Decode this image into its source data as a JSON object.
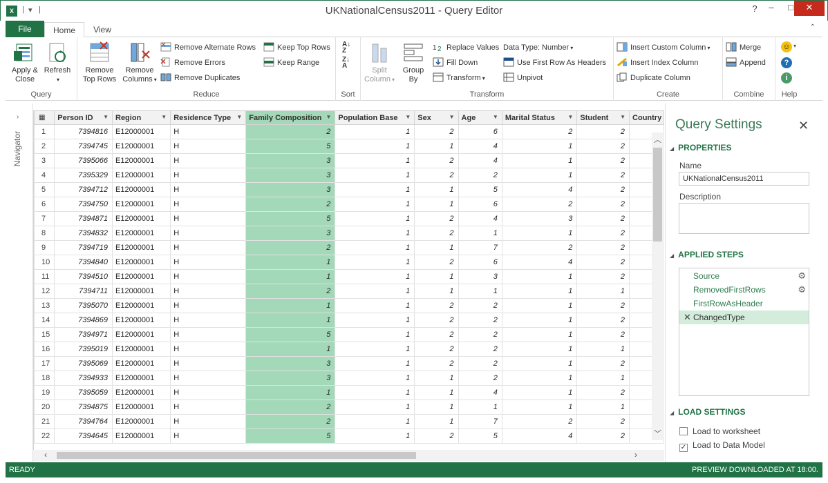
{
  "window": {
    "title": "UKNationalCensus2011 - Query Editor",
    "app_icon": "X"
  },
  "tabs": [
    {
      "label": "File"
    },
    {
      "label": "Home"
    },
    {
      "label": "View"
    }
  ],
  "ribbon": {
    "query": {
      "label": "Query",
      "apply_close": [
        "Apply &",
        "Close"
      ],
      "refresh": "Refresh"
    },
    "reduce": {
      "label": "Reduce",
      "remove_top_rows": [
        "Remove",
        "Top Rows"
      ],
      "remove_columns": [
        "Remove",
        "Columns"
      ],
      "remove_alternate_rows": "Remove Alternate Rows",
      "remove_errors": "Remove Errors",
      "remove_duplicates": "Remove Duplicates",
      "keep_top_rows": "Keep Top Rows",
      "keep_range": "Keep Range"
    },
    "sort": {
      "label": "Sort"
    },
    "transform": {
      "label": "Transform",
      "split_column": [
        "Split",
        "Column"
      ],
      "group_by": [
        "Group",
        "By"
      ],
      "replace_values": "Replace Values",
      "fill_down": "Fill Down",
      "transform": "Transform",
      "data_type": "Data Type: Number",
      "use_first_row": "Use First Row As Headers",
      "unpivot": "Unpivot"
    },
    "create": {
      "label": "Create",
      "insert_custom_column": "Insert Custom Column",
      "insert_index_column": "Insert Index Column",
      "duplicate_column": "Duplicate Column"
    },
    "combine": {
      "label": "Combine",
      "merge": "Merge",
      "append": "Append"
    },
    "help": {
      "label": "Help"
    }
  },
  "navigator": {
    "label": "Navigator"
  },
  "grid": {
    "columns": [
      "Person ID",
      "Region",
      "Residence Type",
      "Family Composition",
      "Population Base",
      "Sex",
      "Age",
      "Marital Status",
      "Student",
      "Country"
    ],
    "rows": [
      [
        "1",
        "7394816",
        "E12000001",
        "H",
        "2",
        "1",
        "2",
        "6",
        "2",
        "2"
      ],
      [
        "2",
        "7394745",
        "E12000001",
        "H",
        "5",
        "1",
        "1",
        "4",
        "1",
        "2"
      ],
      [
        "3",
        "7395066",
        "E12000001",
        "H",
        "3",
        "1",
        "2",
        "4",
        "1",
        "2"
      ],
      [
        "4",
        "7395329",
        "E12000001",
        "H",
        "3",
        "1",
        "2",
        "2",
        "1",
        "2"
      ],
      [
        "5",
        "7394712",
        "E12000001",
        "H",
        "3",
        "1",
        "1",
        "5",
        "4",
        "2"
      ],
      [
        "6",
        "7394750",
        "E12000001",
        "H",
        "2",
        "1",
        "1",
        "6",
        "2",
        "2"
      ],
      [
        "7",
        "7394871",
        "E12000001",
        "H",
        "5",
        "1",
        "2",
        "4",
        "3",
        "2"
      ],
      [
        "8",
        "7394832",
        "E12000001",
        "H",
        "3",
        "1",
        "2",
        "1",
        "1",
        "2"
      ],
      [
        "9",
        "7394719",
        "E12000001",
        "H",
        "2",
        "1",
        "1",
        "7",
        "2",
        "2"
      ],
      [
        "10",
        "7394840",
        "E12000001",
        "H",
        "1",
        "1",
        "2",
        "6",
        "4",
        "2"
      ],
      [
        "11",
        "7394510",
        "E12000001",
        "H",
        "1",
        "1",
        "1",
        "3",
        "1",
        "2"
      ],
      [
        "12",
        "7394711",
        "E12000001",
        "H",
        "2",
        "1",
        "1",
        "1",
        "1",
        "1"
      ],
      [
        "13",
        "7395070",
        "E12000001",
        "H",
        "1",
        "1",
        "2",
        "2",
        "1",
        "2"
      ],
      [
        "14",
        "7394869",
        "E12000001",
        "H",
        "1",
        "1",
        "2",
        "2",
        "1",
        "2"
      ],
      [
        "15",
        "7394971",
        "E12000001",
        "H",
        "5",
        "1",
        "2",
        "2",
        "1",
        "2"
      ],
      [
        "16",
        "7395019",
        "E12000001",
        "H",
        "1",
        "1",
        "2",
        "2",
        "1",
        "1"
      ],
      [
        "17",
        "7395069",
        "E12000001",
        "H",
        "3",
        "1",
        "2",
        "2",
        "1",
        "2"
      ],
      [
        "18",
        "7394933",
        "E12000001",
        "H",
        "3",
        "1",
        "1",
        "2",
        "1",
        "1"
      ],
      [
        "19",
        "7395059",
        "E12000001",
        "H",
        "1",
        "1",
        "1",
        "4",
        "1",
        "2"
      ],
      [
        "20",
        "7394875",
        "E12000001",
        "H",
        "2",
        "1",
        "1",
        "1",
        "1",
        "1"
      ],
      [
        "21",
        "7394764",
        "E12000001",
        "H",
        "2",
        "1",
        "1",
        "7",
        "2",
        "2"
      ],
      [
        "22",
        "7394645",
        "E12000001",
        "H",
        "5",
        "1",
        "2",
        "5",
        "4",
        "2"
      ]
    ]
  },
  "query_settings": {
    "title": "Query Settings",
    "properties_label": "PROPERTIES",
    "name_label": "Name",
    "name_value": "UKNationalCensus2011",
    "description_label": "Description",
    "applied_steps_label": "APPLIED STEPS",
    "steps": [
      "Source",
      "RemovedFirstRows",
      "FirstRowAsHeader",
      "ChangedType"
    ],
    "load_settings_label": "LOAD SETTINGS",
    "load_to_worksheet": "Load to worksheet",
    "load_to_data_model": "Load to Data Model",
    "load_to_worksheet_checked": false,
    "load_to_data_model_checked": true
  },
  "status": {
    "left": "READY",
    "right": "PREVIEW DOWNLOADED AT 18:00."
  },
  "colors": {
    "accent": "#217346",
    "selected_column": "#a3d9b8"
  }
}
